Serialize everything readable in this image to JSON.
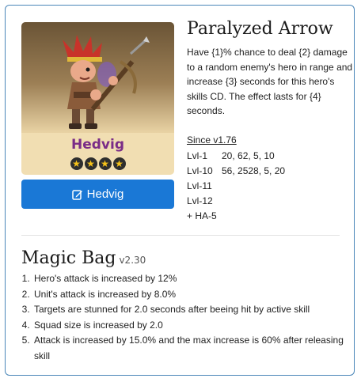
{
  "hero": {
    "name": "Hedvig",
    "stars": 4,
    "button_label": "Hedvig",
    "button_icon": "edit-icon"
  },
  "skill": {
    "title": "Paralyzed Arrow",
    "description": "Have {1}% chance to deal {2} damage to a random enemy's hero in range and increase {3} seconds for this hero's skills CD. The effect lasts for {4} seconds.",
    "since": "Since v1.76",
    "levels": [
      {
        "name": "Lvl-1",
        "value": "20, 62, 5, 10"
      },
      {
        "name": "Lvl-10",
        "value": "56, 2528, 5, 20"
      },
      {
        "name": "Lvl-11",
        "value": ""
      },
      {
        "name": "Lvl-12",
        "value": ""
      },
      {
        "name": "+ HA-5",
        "value": ""
      }
    ]
  },
  "magic_bag": {
    "title": "Magic Bag",
    "version": "v2.30",
    "items": [
      "Hero's attack is increased by 12%",
      "Unit's attack is increased by 8.0%",
      "Targets are stunned for 2.0 seconds after beeing hit by active skill",
      "Squad size is increased by 2.0",
      "Attack is increased by 15.0% and the max increase is 60% after releasing skill"
    ]
  },
  "colors": {
    "accent": "#1a78d6",
    "card_border": "#4a86b8",
    "hero_name": "#7a2c87",
    "star": "#f6c21a"
  }
}
